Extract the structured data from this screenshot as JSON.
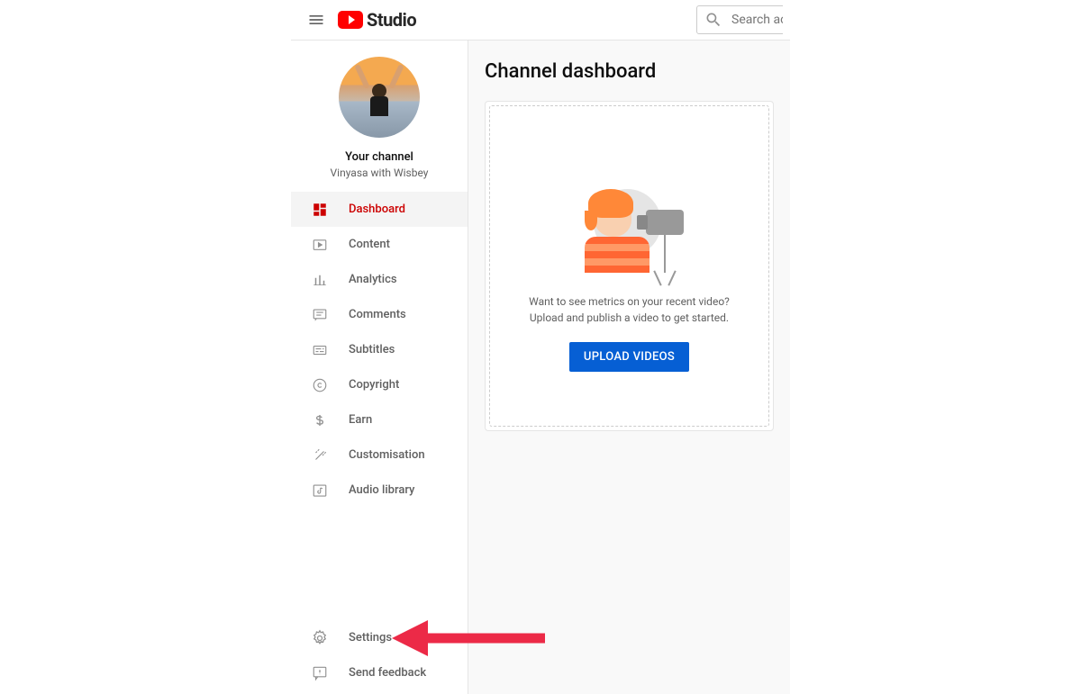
{
  "header": {
    "logo_text": "Studio",
    "search_placeholder": "Search across your channel"
  },
  "channel": {
    "your_channel_label": "Your channel",
    "name": "Vinyasa with Wisbey"
  },
  "nav": {
    "items": [
      {
        "id": "dashboard",
        "label": "Dashboard",
        "icon": "dashboard-icon",
        "active": true
      },
      {
        "id": "content",
        "label": "Content",
        "icon": "content-icon",
        "active": false
      },
      {
        "id": "analytics",
        "label": "Analytics",
        "icon": "analytics-icon",
        "active": false
      },
      {
        "id": "comments",
        "label": "Comments",
        "icon": "comments-icon",
        "active": false
      },
      {
        "id": "subtitles",
        "label": "Subtitles",
        "icon": "subtitles-icon",
        "active": false
      },
      {
        "id": "copyright",
        "label": "Copyright",
        "icon": "copyright-icon",
        "active": false
      },
      {
        "id": "earn",
        "label": "Earn",
        "icon": "earn-icon",
        "active": false
      },
      {
        "id": "customisation",
        "label": "Customisation",
        "icon": "customisation-icon",
        "active": false
      },
      {
        "id": "audiolibrary",
        "label": "Audio library",
        "icon": "audio-library-icon",
        "active": false
      }
    ],
    "bottom": [
      {
        "id": "settings",
        "label": "Settings",
        "icon": "settings-icon"
      },
      {
        "id": "feedback",
        "label": "Send feedback",
        "icon": "feedback-icon"
      }
    ]
  },
  "main": {
    "title": "Channel dashboard",
    "card": {
      "line1": "Want to see metrics on your recent video?",
      "line2": "Upload and publish a video to get started.",
      "button": "UPLOAD VIDEOS"
    }
  },
  "annotation": {
    "arrow_color": "#ec2a47"
  }
}
